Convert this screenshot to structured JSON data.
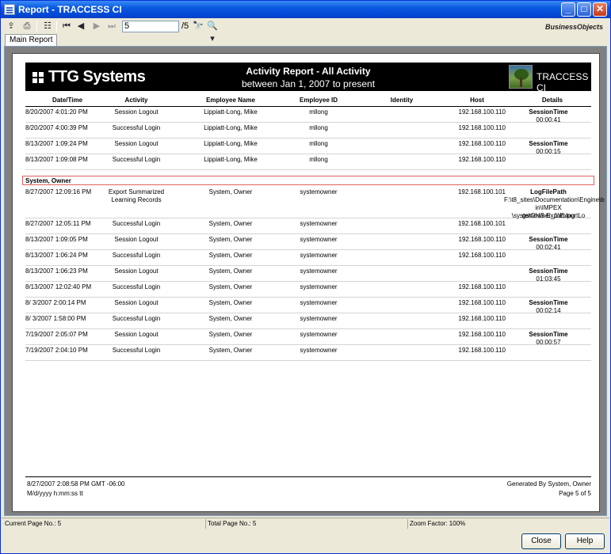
{
  "window": {
    "title": "Report - TRACCESS CI"
  },
  "toolbar": {
    "page_value": "5",
    "page_total": "/5",
    "vendor_logo": "BusinessObjects",
    "icons": [
      "export-icon",
      "print-icon",
      "group-tree-icon",
      "first-page-icon",
      "prev-page-icon",
      "next-page-icon",
      "last-page-icon",
      "find-icon",
      "zoom-icon"
    ]
  },
  "tabs": [
    {
      "label": "Main Report"
    }
  ],
  "report": {
    "brand": "TTG Systems",
    "title": "Activity Report - All Activity",
    "subtitle": "between Jan 1, 2007 to present",
    "right_brand": "TRACCESS CI",
    "columns": {
      "date": "Date/Time",
      "activity": "Activity",
      "employee": "Employee Name",
      "employee_id": "Employee ID",
      "identity": "Identity",
      "host": "Host",
      "details": "Details"
    },
    "group1_rows": [
      {
        "date": "8/20/2007  4:01:20 PM",
        "activity": "Session Logout",
        "employee": "Lippiatt-Long, Mike",
        "employee_id": "mllong",
        "host": "192.168.100.110",
        "detail_label": "SessionTime",
        "detail_value": "00:00:41"
      },
      {
        "date": "8/20/2007  4:00:39 PM",
        "activity": "Successful Login",
        "employee": "Lippiatt-Long, Mike",
        "employee_id": "mllong",
        "host": "192.168.100.110",
        "detail_label": "",
        "detail_value": ""
      },
      {
        "date": "8/13/2007  1:09:24 PM",
        "activity": "Session Logout",
        "employee": "Lippiatt-Long, Mike",
        "employee_id": "mllong",
        "host": "192.168.100.110",
        "detail_label": "SessionTime",
        "detail_value": "00:00:15"
      },
      {
        "date": "8/13/2007  1:09:08 PM",
        "activity": "Successful Login",
        "employee": "Lippiatt-Long, Mike",
        "employee_id": "mllong",
        "host": "192.168.100.110",
        "detail_label": "",
        "detail_value": ""
      }
    ],
    "group2_name": "System, Owner",
    "export_row": {
      "date": "8/27/2007 12:09:16 PM",
      "activity": "Export Summarized",
      "activity2": "Learning Records",
      "employee": "System, Owner",
      "employee_id": "systemowner",
      "host": "192.168.100.101",
      "detail_label": "LogFilePath",
      "path1": "F:\\t8_sites\\Documentation\\Engine\\b",
      "path2": "in\\IMPEX \\systemowner_1\\ExportLo",
      "path3": "gs\\OHS Export.log"
    },
    "group2_rows": [
      {
        "date": "8/27/2007 12:05:11 PM",
        "activity": "Successful Login",
        "employee": "System, Owner",
        "employee_id": "systemowner",
        "host": "192.168.100.101",
        "detail_label": "",
        "detail_value": ""
      },
      {
        "date": "8/13/2007  1:09:05 PM",
        "activity": "Session Logout",
        "employee": "System, Owner",
        "employee_id": "systemowner",
        "host": "192.168.100.110",
        "detail_label": "SessionTime",
        "detail_value": "00:02:41"
      },
      {
        "date": "8/13/2007  1:06:24 PM",
        "activity": "Successful Login",
        "employee": "System, Owner",
        "employee_id": "systemowner",
        "host": "192.168.100.110",
        "detail_label": "",
        "detail_value": ""
      },
      {
        "date": "8/13/2007  1:06:23 PM",
        "activity": "Session Logout",
        "employee": "System, Owner",
        "employee_id": "systemowner",
        "host": "",
        "detail_label": "SessionTime",
        "detail_value": "01:03:45"
      },
      {
        "date": "8/13/2007 12:02:40 PM",
        "activity": "Successful Login",
        "employee": "System, Owner",
        "employee_id": "systemowner",
        "host": "192.168.100.110",
        "detail_label": "",
        "detail_value": ""
      },
      {
        "date": "8/ 3/2007  2:00:14 PM",
        "activity": "Session Logout",
        "employee": "System, Owner",
        "employee_id": "systemowner",
        "host": "192.168.100.110",
        "detail_label": "SessionTime",
        "detail_value": "00:02:14"
      },
      {
        "date": "8/ 3/2007  1:58:00 PM",
        "activity": "Successful Login",
        "employee": "System, Owner",
        "employee_id": "systemowner",
        "host": "192.168.100.110",
        "detail_label": "",
        "detail_value": ""
      },
      {
        "date": "7/19/2007  2:05:07 PM",
        "activity": "Session Logout",
        "employee": "System, Owner",
        "employee_id": "systemowner",
        "host": "192.168.100.110",
        "detail_label": "SessionTime",
        "detail_value": "00:00:57"
      },
      {
        "date": "7/19/2007  2:04:10 PM",
        "activity": "Successful Login",
        "employee": "System, Owner",
        "employee_id": "systemowner",
        "host": "192.168.100.110",
        "detail_label": "",
        "detail_value": ""
      }
    ],
    "footer": {
      "timestamp": "8/27/2007  2:08:58 PM GMT -06:00",
      "format": "M/d/yyyy h:mm:ss tt",
      "generated_by": "Generated By System, Owner",
      "page": "Page 5 of 5"
    }
  },
  "status": {
    "current_page": "Current Page No.: 5",
    "total_page": "Total Page No.: 5",
    "zoom": "Zoom Factor: 100%"
  },
  "buttons": {
    "close": "Close",
    "help": "Help"
  }
}
